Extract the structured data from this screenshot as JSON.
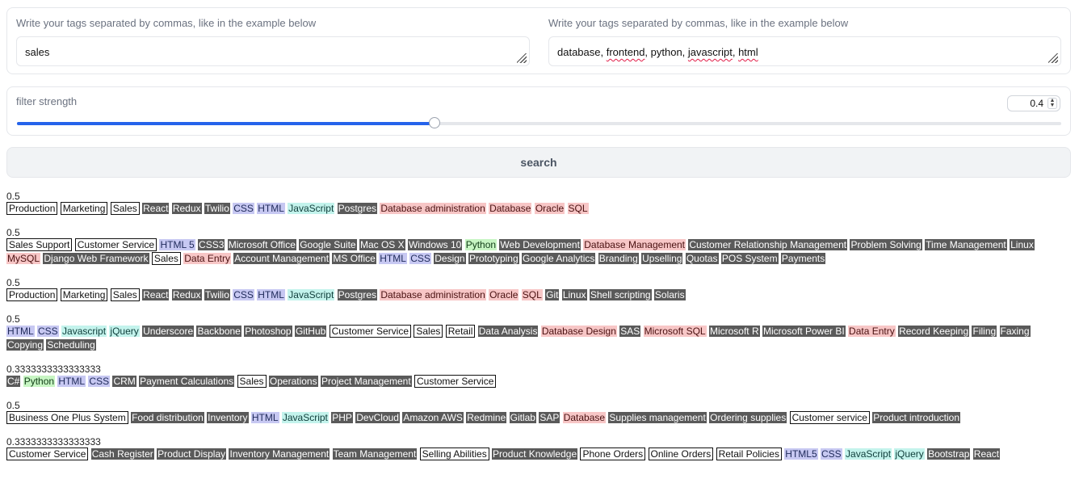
{
  "inputs": {
    "left_label": "Write your tags separated by commas, like in the example below",
    "left_value": "sales",
    "right_label": "Write your tags separated by commas, like in the example below",
    "right_value_words": [
      {
        "text": "database, ",
        "spell": false
      },
      {
        "text": "frontend",
        "spell": true
      },
      {
        "text": ", python, ",
        "spell": false
      },
      {
        "text": "javascript",
        "spell": true
      },
      {
        "text": ", ",
        "spell": false
      },
      {
        "text": "html",
        "spell": true
      }
    ]
  },
  "filter": {
    "label": "filter strength",
    "value": "0.4",
    "value_num": 0.4,
    "max": 1
  },
  "search_label": "search",
  "results": [
    {
      "score": "0.5",
      "tags": [
        [
          "Production",
          "box"
        ],
        [
          "Marketing",
          "box"
        ],
        [
          "Sales",
          "box"
        ],
        [
          "React",
          "gray"
        ],
        [
          "Redux",
          "gray"
        ],
        [
          "Twilio",
          "gray"
        ],
        [
          "CSS",
          "blue"
        ],
        [
          "HTML",
          "blue"
        ],
        [
          "JavaScript",
          "cyan"
        ],
        [
          "Postgres",
          "gray"
        ],
        [
          "Database administration",
          "red"
        ],
        [
          "Database",
          "red"
        ],
        [
          "Oracle",
          "red"
        ],
        [
          "SQL",
          "red"
        ]
      ]
    },
    {
      "score": "0.5",
      "tags": [
        [
          "Sales Support",
          "box"
        ],
        [
          "Customer Service",
          "box"
        ],
        [
          "HTML 5",
          "blue"
        ],
        [
          "CSS3",
          "gray"
        ],
        [
          "Microsoft Office",
          "gray"
        ],
        [
          "Google Suite",
          "gray"
        ],
        [
          "Mac OS X",
          "gray"
        ],
        [
          "Windows 10",
          "gray"
        ],
        [
          "Python",
          "green"
        ],
        [
          "Web Development",
          "gray"
        ],
        [
          "Database Management",
          "red"
        ],
        [
          "Customer Relationship Management",
          "gray"
        ],
        [
          "Problem Solving",
          "gray"
        ],
        [
          "Time Management",
          "gray"
        ],
        [
          "Linux",
          "gray"
        ],
        [
          "MySQL",
          "red"
        ],
        [
          "Django Web Framework",
          "gray"
        ],
        [
          "Sales",
          "box"
        ],
        [
          "Data Entry",
          "red"
        ],
        [
          "Account Management",
          "gray"
        ],
        [
          "MS Office",
          "gray"
        ],
        [
          "HTML",
          "blue"
        ],
        [
          "CSS",
          "blue"
        ],
        [
          "Design",
          "gray"
        ],
        [
          "Prototyping",
          "gray"
        ],
        [
          "Google Analytics",
          "gray"
        ],
        [
          "Branding",
          "gray"
        ],
        [
          "Upselling",
          "gray"
        ],
        [
          "Quotas",
          "gray"
        ],
        [
          "POS System",
          "gray"
        ],
        [
          "Payments",
          "gray"
        ]
      ]
    },
    {
      "score": "0.5",
      "tags": [
        [
          "Production",
          "box"
        ],
        [
          "Marketing",
          "box"
        ],
        [
          "Sales",
          "box"
        ],
        [
          "React",
          "gray"
        ],
        [
          "Redux",
          "gray"
        ],
        [
          "Twilio",
          "gray"
        ],
        [
          "CSS",
          "blue"
        ],
        [
          "HTML",
          "blue"
        ],
        [
          "JavaScript",
          "cyan"
        ],
        [
          "Postgres",
          "gray"
        ],
        [
          "Database administration",
          "red"
        ],
        [
          "Oracle",
          "red"
        ],
        [
          "SQL",
          "red"
        ],
        [
          "Git",
          "gray"
        ],
        [
          "Linux",
          "gray"
        ],
        [
          "Shell scripting",
          "gray"
        ],
        [
          "Solaris",
          "gray"
        ]
      ]
    },
    {
      "score": "0.5",
      "tags": [
        [
          "HTML",
          "blue"
        ],
        [
          "CSS",
          "blue"
        ],
        [
          "Javascript",
          "cyan"
        ],
        [
          "jQuery",
          "cyan"
        ],
        [
          "Underscore",
          "gray"
        ],
        [
          "Backbone",
          "gray"
        ],
        [
          "Photoshop",
          "gray"
        ],
        [
          "GitHub",
          "gray"
        ],
        [
          "Customer Service",
          "box"
        ],
        [
          "Sales",
          "box"
        ],
        [
          "Retail",
          "box"
        ],
        [
          "Data Analysis",
          "gray"
        ],
        [
          "Database Design",
          "red"
        ],
        [
          "SAS",
          "gray"
        ],
        [
          "Microsoft SQL",
          "red"
        ],
        [
          "Microsoft R",
          "gray"
        ],
        [
          "Microsoft Power BI",
          "gray"
        ],
        [
          "Data Entry",
          "red"
        ],
        [
          "Record Keeping",
          "gray"
        ],
        [
          "Filing",
          "gray"
        ],
        [
          "Faxing",
          "gray"
        ],
        [
          "Copying",
          "gray"
        ],
        [
          "Scheduling",
          "gray"
        ]
      ]
    },
    {
      "score": "0.3333333333333333",
      "tags": [
        [
          "C#",
          "gray"
        ],
        [
          "Python",
          "green"
        ],
        [
          "HTML",
          "blue"
        ],
        [
          "CSS",
          "blue"
        ],
        [
          "CRM",
          "gray"
        ],
        [
          "Payment Calculations",
          "gray"
        ],
        [
          "Sales",
          "box"
        ],
        [
          "Operations",
          "gray"
        ],
        [
          "Project Management",
          "gray"
        ],
        [
          "Customer Service",
          "box"
        ]
      ]
    },
    {
      "score": "0.5",
      "tags": [
        [
          "Business One Plus System",
          "box"
        ],
        [
          "Food distribution",
          "gray"
        ],
        [
          "Inventory",
          "gray"
        ],
        [
          "HTML",
          "blue"
        ],
        [
          "JavaScript",
          "cyan"
        ],
        [
          "PHP",
          "gray"
        ],
        [
          "DevCloud",
          "gray"
        ],
        [
          "Amazon AWS",
          "gray"
        ],
        [
          "Redmine",
          "gray"
        ],
        [
          "Gitlab",
          "gray"
        ],
        [
          "SAP",
          "gray"
        ],
        [
          "Database",
          "red"
        ],
        [
          "Supplies management",
          "gray"
        ],
        [
          "Ordering supplies",
          "gray"
        ],
        [
          "Customer service",
          "box"
        ],
        [
          "Product introduction",
          "gray"
        ]
      ]
    },
    {
      "score": "0.3333333333333333",
      "tags": [
        [
          "Customer Service",
          "box"
        ],
        [
          "Cash Register",
          "gray"
        ],
        [
          "Product Display",
          "gray"
        ],
        [
          "Inventory Management",
          "gray"
        ],
        [
          "Team Management",
          "gray"
        ],
        [
          "Selling Abilities",
          "box"
        ],
        [
          "Product Knowledge",
          "gray"
        ],
        [
          "Phone Orders",
          "box"
        ],
        [
          "Online Orders",
          "box"
        ],
        [
          "Retail Policies",
          "box"
        ],
        [
          "HTML5",
          "blue"
        ],
        [
          "CSS",
          "blue"
        ],
        [
          "JavaScript",
          "cyan"
        ],
        [
          "jQuery",
          "cyan"
        ],
        [
          "Bootstrap",
          "gray"
        ],
        [
          "React",
          "gray"
        ]
      ]
    }
  ]
}
